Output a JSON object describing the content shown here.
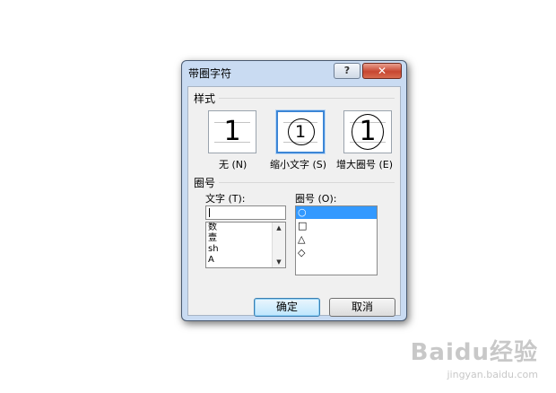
{
  "dialog": {
    "title": "带圈字符",
    "help_label": "?",
    "close_label": "✕"
  },
  "style_section": {
    "title": "样式",
    "options": [
      {
        "label": "无 (N)",
        "glyph": "1"
      },
      {
        "label": "缩小文字 (S)",
        "glyph": "1",
        "selected": true
      },
      {
        "label": "增大圈号 (E)",
        "glyph": "1"
      }
    ]
  },
  "enclosure_section": {
    "title": "圈号",
    "text_label": "文字 (T):",
    "text_value": "",
    "text_items": [
      "数",
      "壹",
      "sh",
      "A"
    ],
    "ring_label": "圈号 (O):",
    "ring_items": [
      "○",
      "□",
      "△",
      "◇"
    ],
    "ring_selected_index": 0
  },
  "buttons": {
    "ok": "确定",
    "cancel": "取消"
  },
  "watermark": {
    "main": "Baidu经验",
    "sub": "jingyan.baidu.com"
  }
}
